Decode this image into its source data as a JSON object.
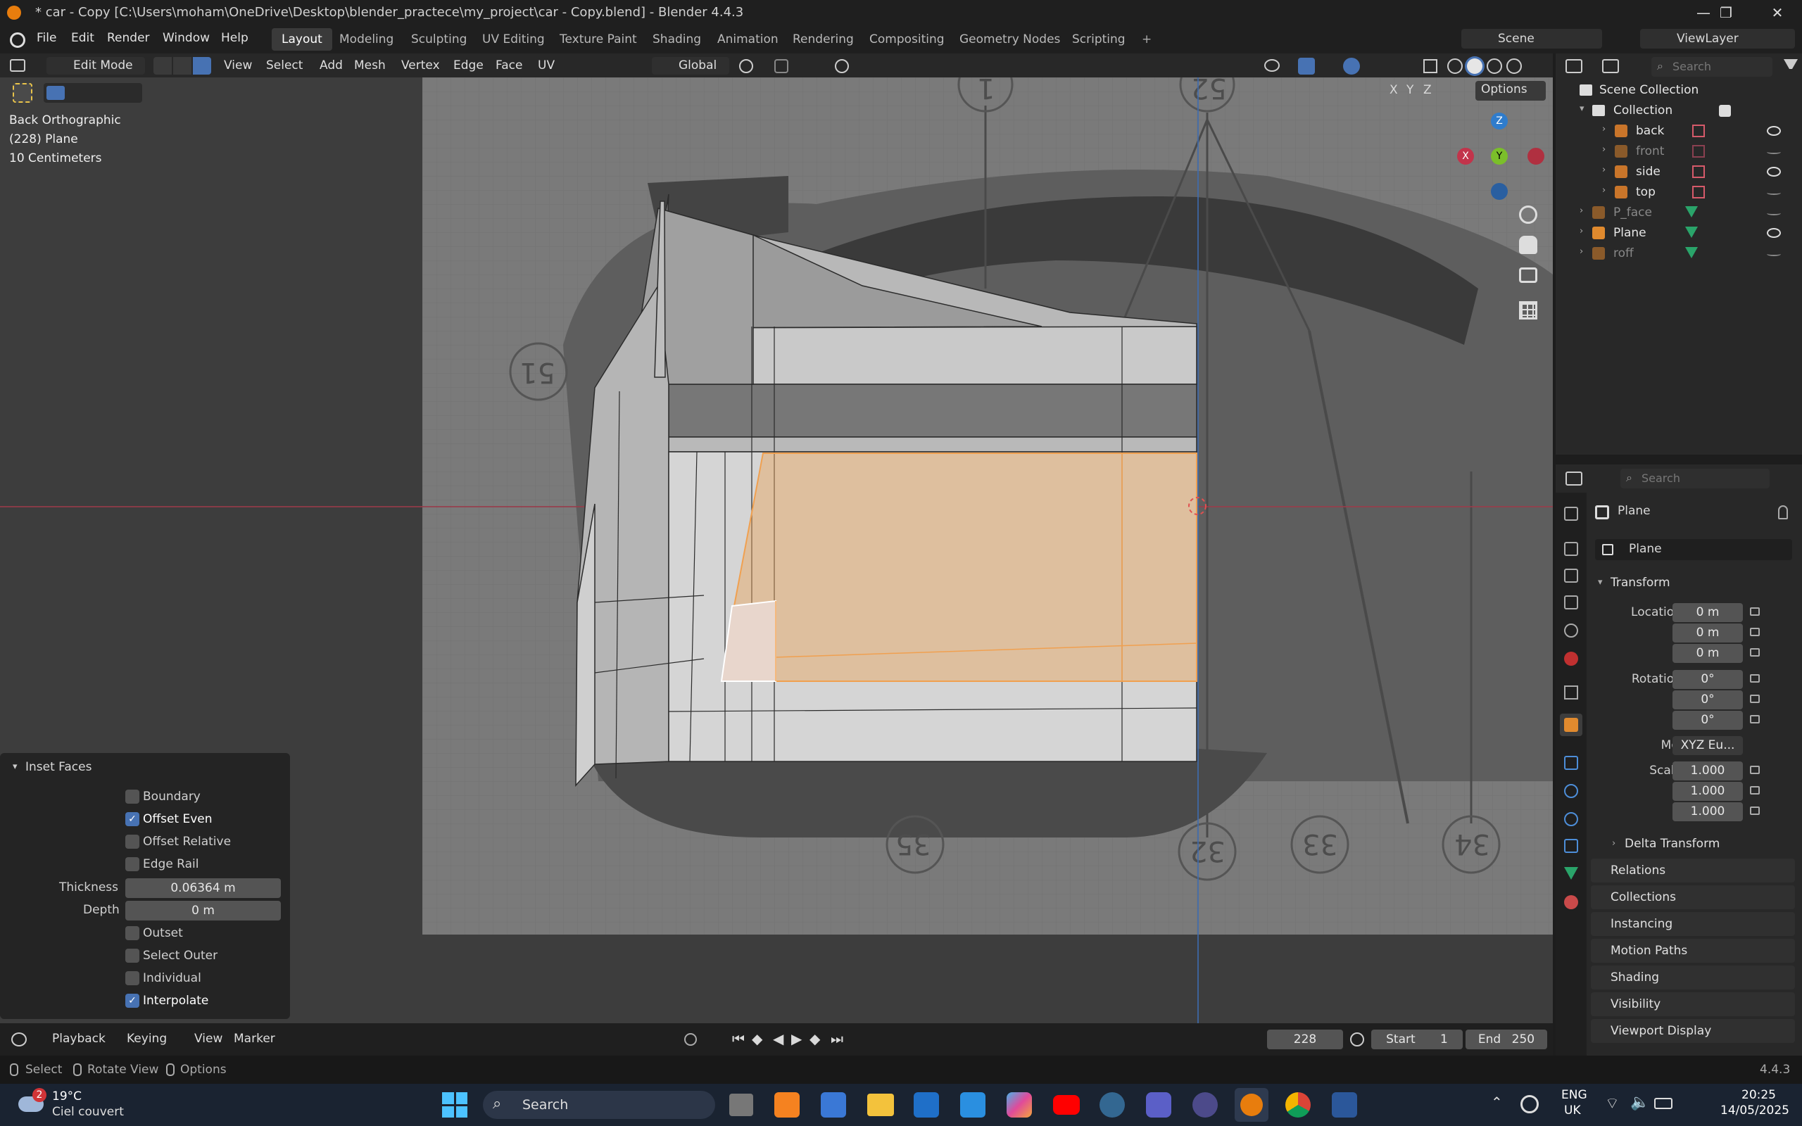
{
  "window": {
    "title": "* car - Copy [C:\\Users\\moham\\OneDrive\\Desktop\\blender_practece\\my_project\\car - Copy.blend] - Blender 4.4.3",
    "min_symbol": "—",
    "max_symbol": "❐",
    "close_symbol": "✕"
  },
  "menu": [
    "File",
    "Edit",
    "Render",
    "Window",
    "Help"
  ],
  "workspaces": [
    "Layout",
    "Modeling",
    "Sculpting",
    "UV Editing",
    "Texture Paint",
    "Shading",
    "Animation",
    "Rendering",
    "Compositing",
    "Geometry Nodes",
    "Scripting"
  ],
  "active_workspace": "Layout",
  "add_workspace": "+",
  "scene": {
    "name": "Scene",
    "view_layer": "ViewLayer"
  },
  "viewport_header": {
    "mode": "Edit Mode",
    "menus": [
      "View",
      "Select",
      "Add",
      "Mesh",
      "Vertex",
      "Edge",
      "Face",
      "UV"
    ],
    "orientation": "Global",
    "options": "Options",
    "axes": [
      "X",
      "Y",
      "Z"
    ]
  },
  "viewport_info": {
    "view": "Back Orthographic",
    "object": "(228) Plane",
    "scale": "10 Centimeters"
  },
  "ref_numbers": [
    "1",
    "52",
    "51",
    "35",
    "32",
    "33",
    "34"
  ],
  "gizmo": {
    "z": "Z",
    "y": "Y",
    "x": "X"
  },
  "colors": {
    "accent": "#4772b3",
    "selection": "#e8a45c",
    "active_tab": "#3a3a3a",
    "x_axis": "#c2344b",
    "y_axis": "#7bbf2a",
    "z_axis": "#2f7ccc"
  },
  "inset_faces": {
    "title": "Inset Faces",
    "options": [
      {
        "label": "Boundary",
        "checked": false
      },
      {
        "label": "Offset Even",
        "checked": true
      },
      {
        "label": "Offset Relative",
        "checked": false
      },
      {
        "label": "Edge Rail",
        "checked": false
      }
    ],
    "thickness_label": "Thickness",
    "thickness": "0.06364 m",
    "depth_label": "Depth",
    "depth": "0 m",
    "options2": [
      {
        "label": "Outset",
        "checked": false
      },
      {
        "label": "Select Outer",
        "checked": false
      },
      {
        "label": "Individual",
        "checked": false
      },
      {
        "label": "Interpolate",
        "checked": true
      }
    ]
  },
  "timeline": {
    "menus": [
      "Playback",
      "Keying",
      "View",
      "Marker"
    ],
    "current_frame": "228",
    "start_label": "Start",
    "start": "1",
    "end_label": "End",
    "end": "250"
  },
  "statusbar": {
    "items": [
      "Select",
      "Rotate View",
      "Options"
    ],
    "version": "4.4.3"
  },
  "outliner": {
    "search_placeholder": "Search",
    "root": "Scene Collection",
    "collection": "Collection",
    "items": [
      "back",
      "front",
      "side",
      "top"
    ],
    "objects": [
      "P_face",
      "Plane",
      "roff"
    ]
  },
  "properties": {
    "search_placeholder": "Search",
    "object_name": "Plane",
    "data_name": "Plane",
    "transform": "Transform",
    "location_label": "Location X",
    "location": [
      "0 m",
      "0 m",
      "0 m"
    ],
    "rotation_label": "Rotation X",
    "rotation": [
      "0°",
      "0°",
      "0°"
    ],
    "mode_label": "Mode",
    "mode": "XYZ Eu...",
    "scale_label": "Scale X",
    "scale": [
      "1.000",
      "1.000",
      "1.000"
    ],
    "axis_y": "Y",
    "axis_z": "Z",
    "delta": "Delta Transform",
    "sections": [
      "Relations",
      "Collections",
      "Instancing",
      "Motion Paths",
      "Shading",
      "Visibility",
      "Viewport Display"
    ]
  },
  "taskbar": {
    "weather_temp": "19°C",
    "weather_desc": "Ciel couvert",
    "weather_badge": "2",
    "search": "Search",
    "lang1": "ENG",
    "lang2": "UK",
    "time": "20:25",
    "date": "14/05/2025"
  }
}
